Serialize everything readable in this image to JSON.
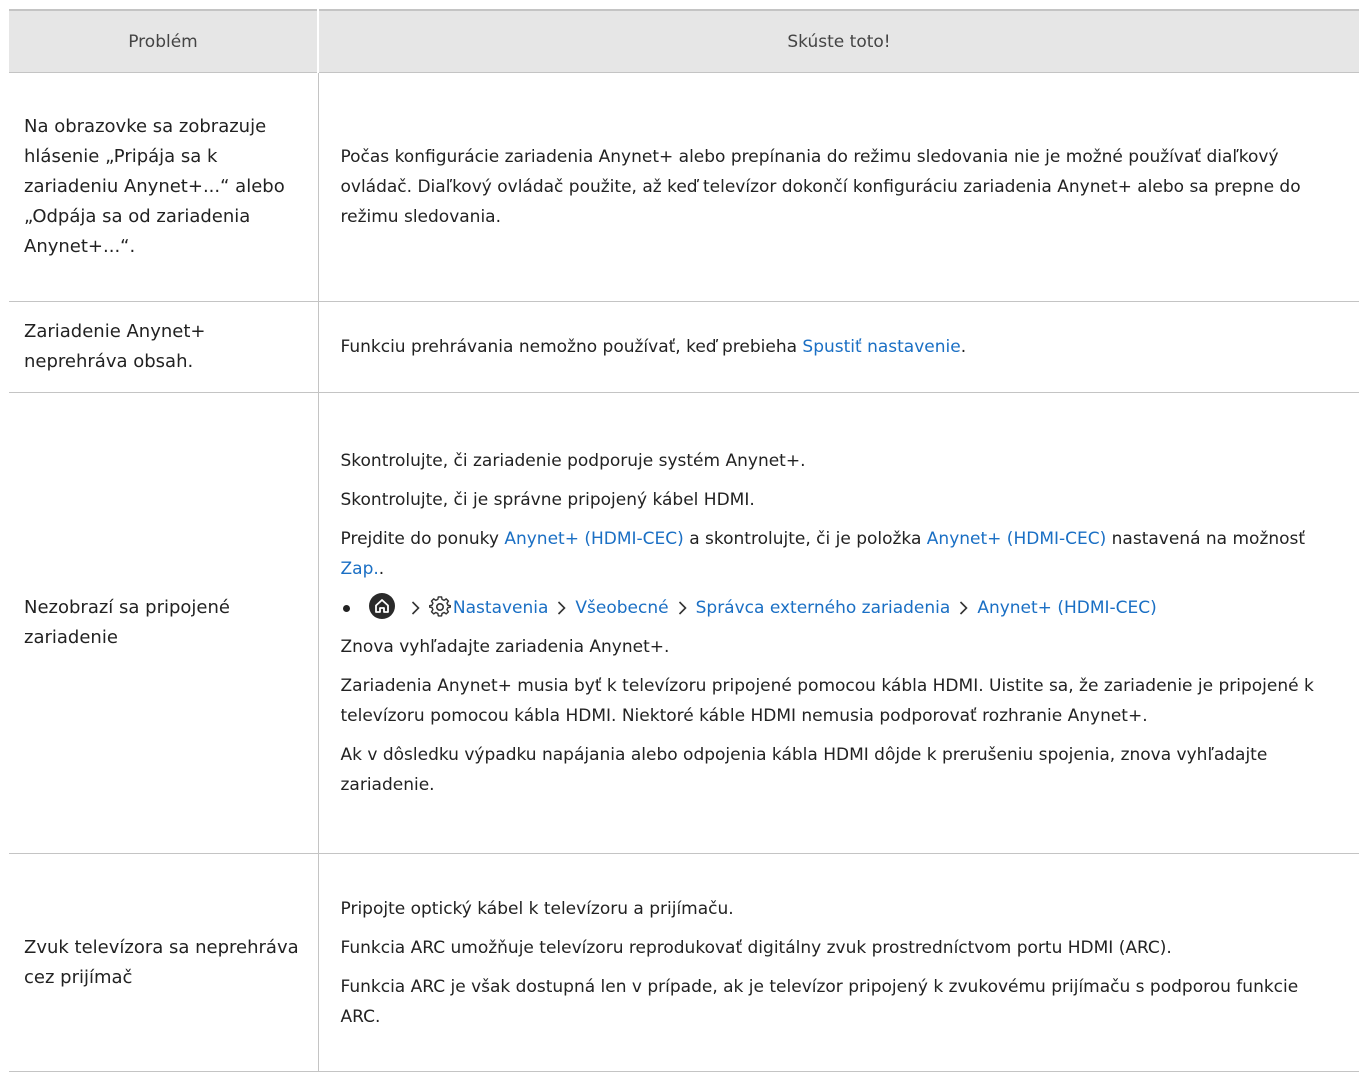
{
  "header": {
    "col1": "Problém",
    "col2": "Skúste toto!"
  },
  "row1": {
    "problem": "Na obrazovke sa zobrazuje hlásenie „Pripája sa k zariadeniu Anynet+...“ alebo „Odpája sa od zariadenia Anynet+...“.",
    "solution": "Počas konfigurácie zariadenia Anynet+ alebo prepínania do režimu sledovania nie je možné používať diaľkový ovládač. Diaľkový ovládač použite, až keď televízor dokončí konfiguráciu zariadenia Anynet+ alebo sa prepne do režimu sledovania."
  },
  "row2": {
    "problem": "Zariadenie Anynet+ neprehráva obsah.",
    "solution_before": "Funkciu prehrávania nemožno používať, keď prebieha ",
    "solution_link": "Spustiť nastavenie",
    "solution_after": "."
  },
  "row3": {
    "problem": "Nezobrazí sa pripojené zariadenie",
    "p1": "Skontrolujte, či zariadenie podporuje systém Anynet+.",
    "p2": "Skontrolujte, či je správne pripojený kábel HDMI.",
    "p3_a": "Prejdite do ponuky ",
    "p3_link1": "Anynet+ (HDMI-CEC)",
    "p3_b": " a skontrolujte, či je položka ",
    "p3_link2": "Anynet+ (HDMI-CEC)",
    "p3_c": " nastavená na možnosť ",
    "p3_link3": "Zap.",
    "p3_d": ".",
    "path": {
      "home_icon": "home-icon",
      "settings_icon": "gear-icon",
      "item1": "Nastavenia",
      "item2": "Všeobecné",
      "item3": "Správca externého zariadenia",
      "item4": "Anynet+ (HDMI-CEC)"
    },
    "p4": "Znova vyhľadajte zariadenia Anynet+.",
    "p5": "Zariadenia Anynet+ musia byť k televízoru pripojené pomocou kábla HDMI. Uistite sa, že zariadenie je pripojené k televízoru pomocou kábla HDMI. Niektoré káble HDMI nemusia podporovať rozhranie Anynet+.",
    "p6": "Ak v dôsledku výpadku napájania alebo odpojenia kábla HDMI dôjde k prerušeniu spojenia, znova vyhľadajte zariadenie."
  },
  "row4": {
    "problem": "Zvuk televízora sa neprehráva cez prijímač",
    "p1": "Pripojte optický kábel k televízoru a prijímaču.",
    "p2": "Funkcia ARC umožňuje televízoru reprodukovať digitálny zvuk prostredníctvom portu HDMI (ARC).",
    "p3": "Funkcia ARC je však dostupná len v prípade, ak je televízor pripojený k zvukovému prijímaču s podporou funkcie ARC."
  },
  "colors": {
    "link": "#1a6fc4",
    "header_bg": "#e6e6e6",
    "border": "#c4c4c4"
  }
}
